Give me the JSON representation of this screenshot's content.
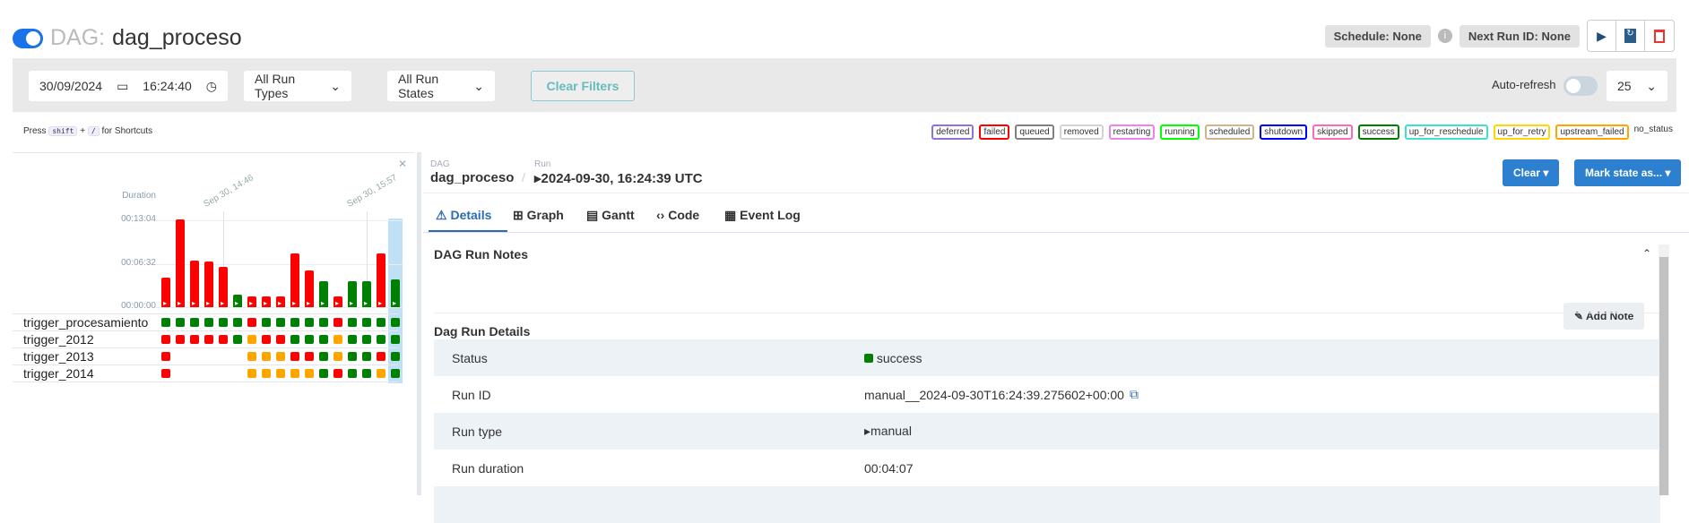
{
  "header": {
    "prefix": "DAG:",
    "dag_id": "dag_proceso",
    "schedule": "Schedule: None",
    "next_run": "Next Run ID: None"
  },
  "filters": {
    "date": "30/09/2024",
    "time": "16:24:40",
    "run_types": "All Run Types",
    "run_states": "All Run States",
    "clear": "Clear Filters",
    "auto_refresh": "Auto-refresh",
    "page_size": "25"
  },
  "shortcut": {
    "press": "Press",
    "key1": "shift",
    "plus": "+",
    "key2": "/",
    "suffix": "for Shortcuts"
  },
  "legend": [
    {
      "label": "deferred",
      "color": "#9370db"
    },
    {
      "label": "failed",
      "color": "#ff0000"
    },
    {
      "label": "queued",
      "color": "#808080"
    },
    {
      "label": "removed",
      "color": "#d3d3d3"
    },
    {
      "label": "restarting",
      "color": "#ee82ee"
    },
    {
      "label": "running",
      "color": "#00ff00"
    },
    {
      "label": "scheduled",
      "color": "#d2b48c"
    },
    {
      "label": "shutdown",
      "color": "#0000ff"
    },
    {
      "label": "skipped",
      "color": "#ff69b4"
    },
    {
      "label": "success",
      "color": "#008000"
    },
    {
      "label": "up_for_reschedule",
      "color": "#40e0d0"
    },
    {
      "label": "up_for_retry",
      "color": "#ffd700"
    },
    {
      "label": "upstream_failed",
      "color": "#ffa500"
    },
    {
      "label": "no_status",
      "color": ""
    }
  ],
  "chart_data": {
    "type": "bar",
    "title": "Duration",
    "ylabel": "Duration",
    "yticks": [
      "00:00:00",
      "00:06:32",
      "00:13:04"
    ],
    "ylim_seconds": [
      0,
      784
    ],
    "date_labels": [
      "Sep 30, 14:46",
      "Sep 30, 15:57"
    ],
    "durations_seconds": [
      268,
      790,
      421,
      413,
      365,
      115,
      99,
      99,
      99,
      486,
      333,
      236,
      99,
      236,
      236,
      486,
      247
    ],
    "run_states": [
      "failed",
      "failed",
      "failed",
      "failed",
      "failed",
      "success",
      "failed",
      "failed",
      "failed",
      "failed",
      "failed",
      "success",
      "failed",
      "success",
      "success",
      "failed",
      "success"
    ]
  },
  "grid": {
    "tasks": [
      {
        "name": "trigger_procesamiento",
        "states": [
          "S",
          "S",
          "S",
          "S",
          "S",
          "S",
          "F",
          "S",
          "S",
          "S",
          "S",
          "S",
          "F",
          "S",
          "S",
          "S",
          "S"
        ]
      },
      {
        "name": "trigger_2012",
        "states": [
          "F",
          "F",
          "F",
          "F",
          "F",
          "S",
          "U",
          "F",
          "F",
          "S",
          "S",
          "S",
          "U",
          "S",
          "S",
          "S",
          "S"
        ]
      },
      {
        "name": "trigger_2013",
        "states": [
          "F",
          "",
          "",
          "",
          "",
          "",
          "U",
          "U",
          "U",
          "F",
          "F",
          "S",
          "U",
          "S",
          "S",
          "F",
          "S"
        ]
      },
      {
        "name": "trigger_2014",
        "states": [
          "F",
          "",
          "",
          "",
          "",
          "",
          "U",
          "U",
          "U",
          "U",
          "U",
          "S",
          "F",
          "S",
          "S",
          "U",
          "S"
        ]
      }
    ]
  },
  "run": {
    "dag_label": "DAG",
    "dag": "dag_proceso",
    "run_label": "Run",
    "run": "2024-09-30, 16:24:39 UTC",
    "clear": "Clear ▾",
    "mark": "Mark state as... ▾"
  },
  "tabs": [
    "Details",
    "Graph",
    "Gantt",
    "Code",
    "Event Log"
  ],
  "notes": {
    "title": "DAG Run Notes",
    "add": "Add Note"
  },
  "details": {
    "title": "Dag Run Details",
    "rows": [
      {
        "k": "Status",
        "v": "success"
      },
      {
        "k": "Run ID",
        "v": "manual__2024-09-30T16:24:39.275602+00:00"
      },
      {
        "k": "Run type",
        "v": "manual"
      },
      {
        "k": "Run duration",
        "v": "00:04:07"
      }
    ]
  }
}
